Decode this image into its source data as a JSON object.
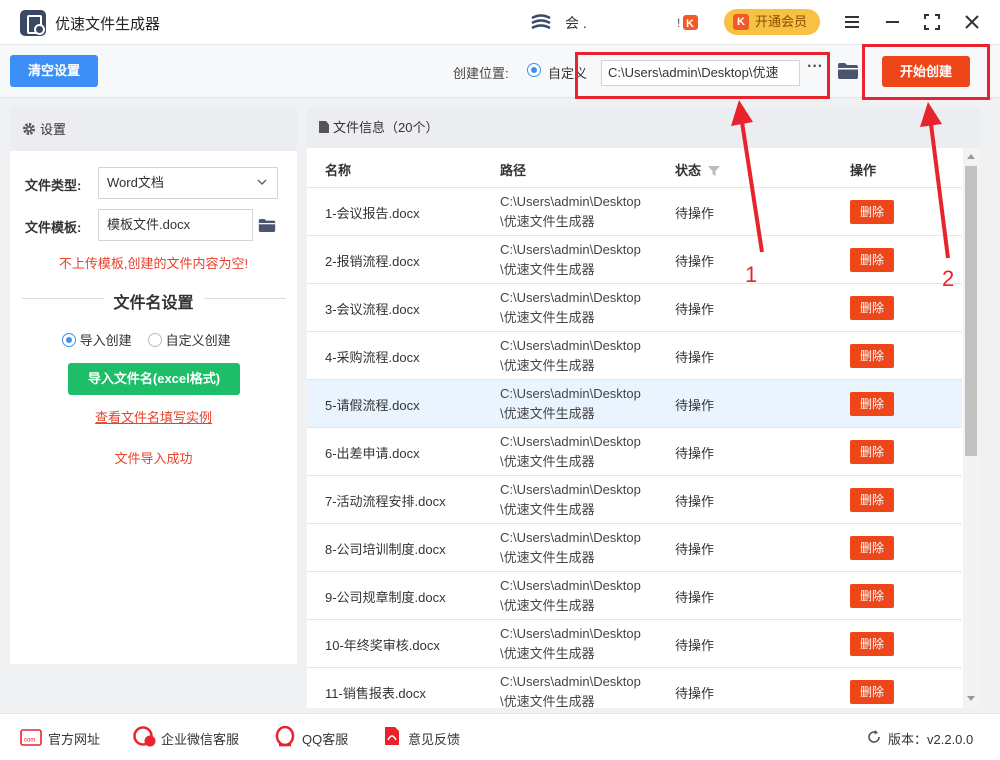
{
  "app": {
    "title": "优速文件生成器",
    "user_name": "会 .",
    "vip_label": "开通会员",
    "vip_badge": "K"
  },
  "toolbar": {
    "clear_label": "清空设置",
    "location_label": "创建位置:",
    "custom_label": "自定义",
    "path_value": "C:\\Users\\admin\\Desktop\\优速",
    "more_label": "···",
    "start_label": "开始创建"
  },
  "settings": {
    "header": "设置",
    "file_type_label": "文件类型:",
    "file_type_value": "Word文档",
    "template_label": "文件模板:",
    "template_value": "模板文件.docx",
    "warning": "不上传模板,创建的文件内容为空!",
    "filename_section": "文件名设置",
    "mode_import": "导入创建",
    "mode_custom": "自定义创建",
    "import_button": "导入文件名(excel格式)",
    "example_link": "查看文件名填写实例",
    "import_status": "文件导入成功"
  },
  "file_info": {
    "header": "文件信息（20个）",
    "columns": [
      "名称",
      "路径",
      "状态",
      "操作"
    ],
    "rows": [
      {
        "name": "1-会议报告.docx",
        "path": "C:\\Users\\admin\\Desktop\\优速文件生成器",
        "status": "待操作",
        "action": "删除"
      },
      {
        "name": "2-报销流程.docx",
        "path": "C:\\Users\\admin\\Desktop\\优速文件生成器",
        "status": "待操作",
        "action": "删除"
      },
      {
        "name": "3-会议流程.docx",
        "path": "C:\\Users\\admin\\Desktop\\优速文件生成器",
        "status": "待操作",
        "action": "删除"
      },
      {
        "name": "4-采购流程.docx",
        "path": "C:\\Users\\admin\\Desktop\\优速文件生成器",
        "status": "待操作",
        "action": "删除"
      },
      {
        "name": "5-请假流程.docx",
        "path": "C:\\Users\\admin\\Desktop\\优速文件生成器",
        "status": "待操作",
        "action": "删除"
      },
      {
        "name": "6-出差申请.docx",
        "path": "C:\\Users\\admin\\Desktop\\优速文件生成器",
        "status": "待操作",
        "action": "删除"
      },
      {
        "name": "7-活动流程安排.docx",
        "path": "C:\\Users\\admin\\Desktop\\优速文件生成器",
        "status": "待操作",
        "action": "删除"
      },
      {
        "name": "8-公司培训制度.docx",
        "path": "C:\\Users\\admin\\Desktop\\优速文件生成器",
        "status": "待操作",
        "action": "删除"
      },
      {
        "name": "9-公司规章制度.docx",
        "path": "C:\\Users\\admin\\Desktop\\优速文件生成器",
        "status": "待操作",
        "action": "删除"
      },
      {
        "name": "10-年终奖审核.docx",
        "path": "C:\\Users\\admin\\Desktop\\优速文件生成器",
        "status": "待操作",
        "action": "删除"
      },
      {
        "name": "11-销售报表.docx",
        "path": "C:\\Users\\admin\\Desktop\\优速文件生成器",
        "status": "待操作",
        "action": "删除"
      }
    ]
  },
  "footer": {
    "website": "官方网址",
    "wechat": "企业微信客服",
    "qq": "QQ客服",
    "feedback": "意见反馈",
    "version": "版本：v2.2.0.0"
  },
  "annotations": [
    "1",
    "2"
  ],
  "colors": {
    "accent_blue": "#3b8ff5",
    "action_red": "#ee4519",
    "green": "#1dbe67",
    "annotation_red": "#e8232e",
    "vip_gold": "#f7c244"
  }
}
